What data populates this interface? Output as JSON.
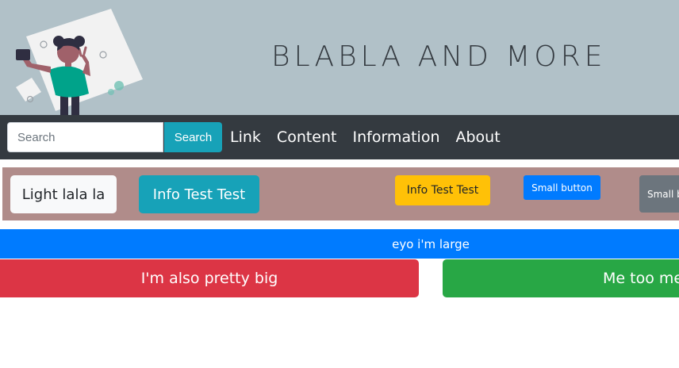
{
  "header": {
    "title": "BLABLA AND MORE",
    "background_color": "#b1c1c8",
    "illustration": "person-taking-selfie-illustration"
  },
  "navbar": {
    "background_color": "#343a40",
    "search": {
      "placeholder": "Search",
      "value": "",
      "button_label": "Search",
      "button_color": "#17a2b8"
    },
    "links": [
      {
        "label": "Link"
      },
      {
        "label": "Content"
      },
      {
        "label": "Information"
      },
      {
        "label": "About"
      }
    ]
  },
  "button_strip": {
    "background_color": "#b08c8a",
    "buttons": [
      {
        "label": "Light lala la",
        "color": "#f8f9fa"
      },
      {
        "label": "Info Test Test",
        "color": "#17a2b8"
      },
      {
        "label": "Info Test Test",
        "color": "#ffc107"
      },
      {
        "label": "Small button",
        "color": "#007bff"
      },
      {
        "label": "Small button",
        "color": "#6c757d"
      }
    ]
  },
  "large_buttons": [
    {
      "label": "eyo i'm large",
      "color": "#007bff"
    },
    {
      "label": "I'm also pretty big",
      "color": "#dc3545"
    },
    {
      "label": "Me too me too",
      "color": "#28a745"
    }
  ]
}
